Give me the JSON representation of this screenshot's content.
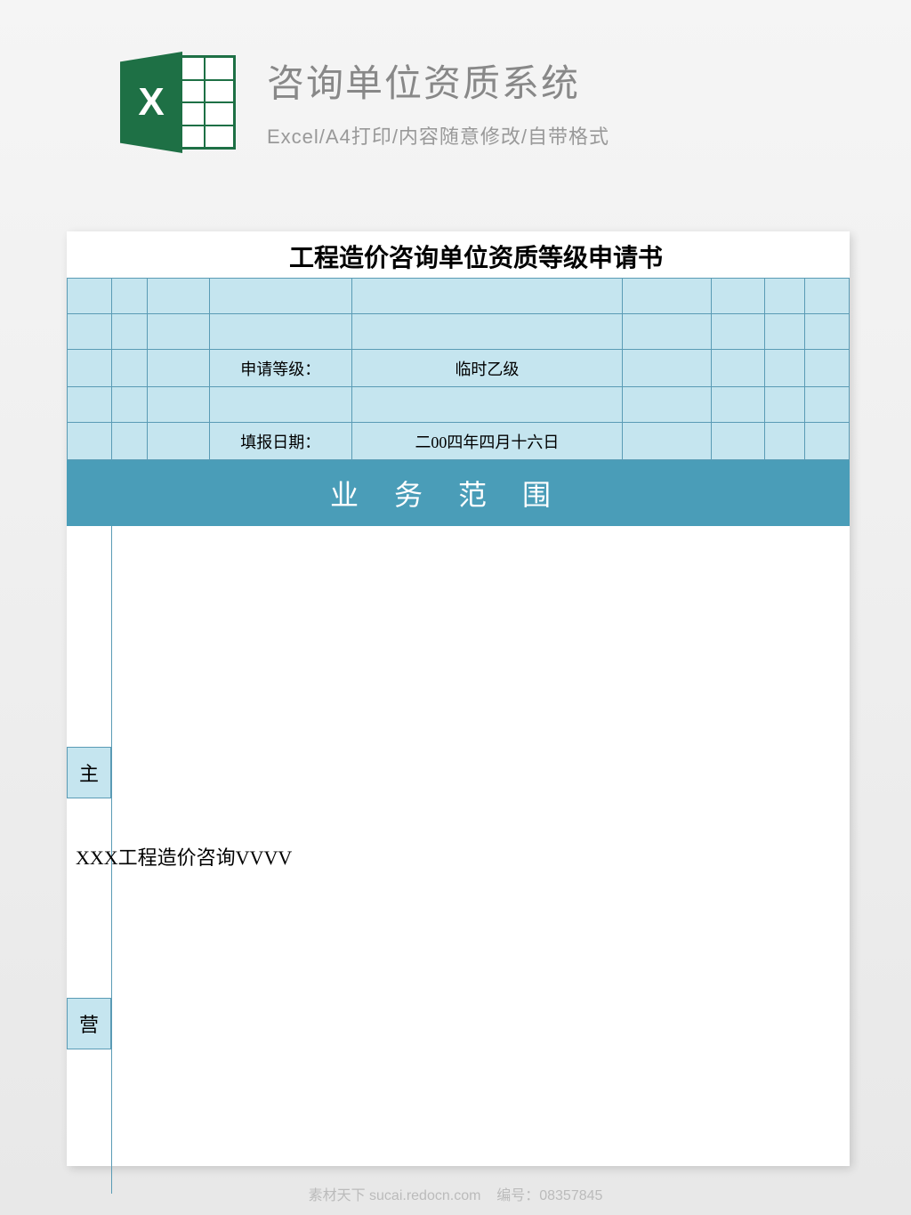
{
  "header": {
    "title": "咨询单位资质系统",
    "subtitle": "Excel/A4打印/内容随意修改/自带格式",
    "icon_letter": "X"
  },
  "document": {
    "title": "工程造价咨询单位资质等级申请书",
    "form": {
      "level_label": "申请等级：",
      "level_value": "临时乙级",
      "date_label": "填报日期：",
      "date_value": "二00四年四月十六日"
    },
    "section_banner": "业务范围",
    "side_labels": {
      "label1": "主",
      "label2": "营"
    },
    "content_text": "XXX工程造价咨询VVVV"
  },
  "watermark": {
    "site": "素材天下 sucai.redocn.com",
    "id_label": "编号：",
    "id_value": "08357845"
  }
}
